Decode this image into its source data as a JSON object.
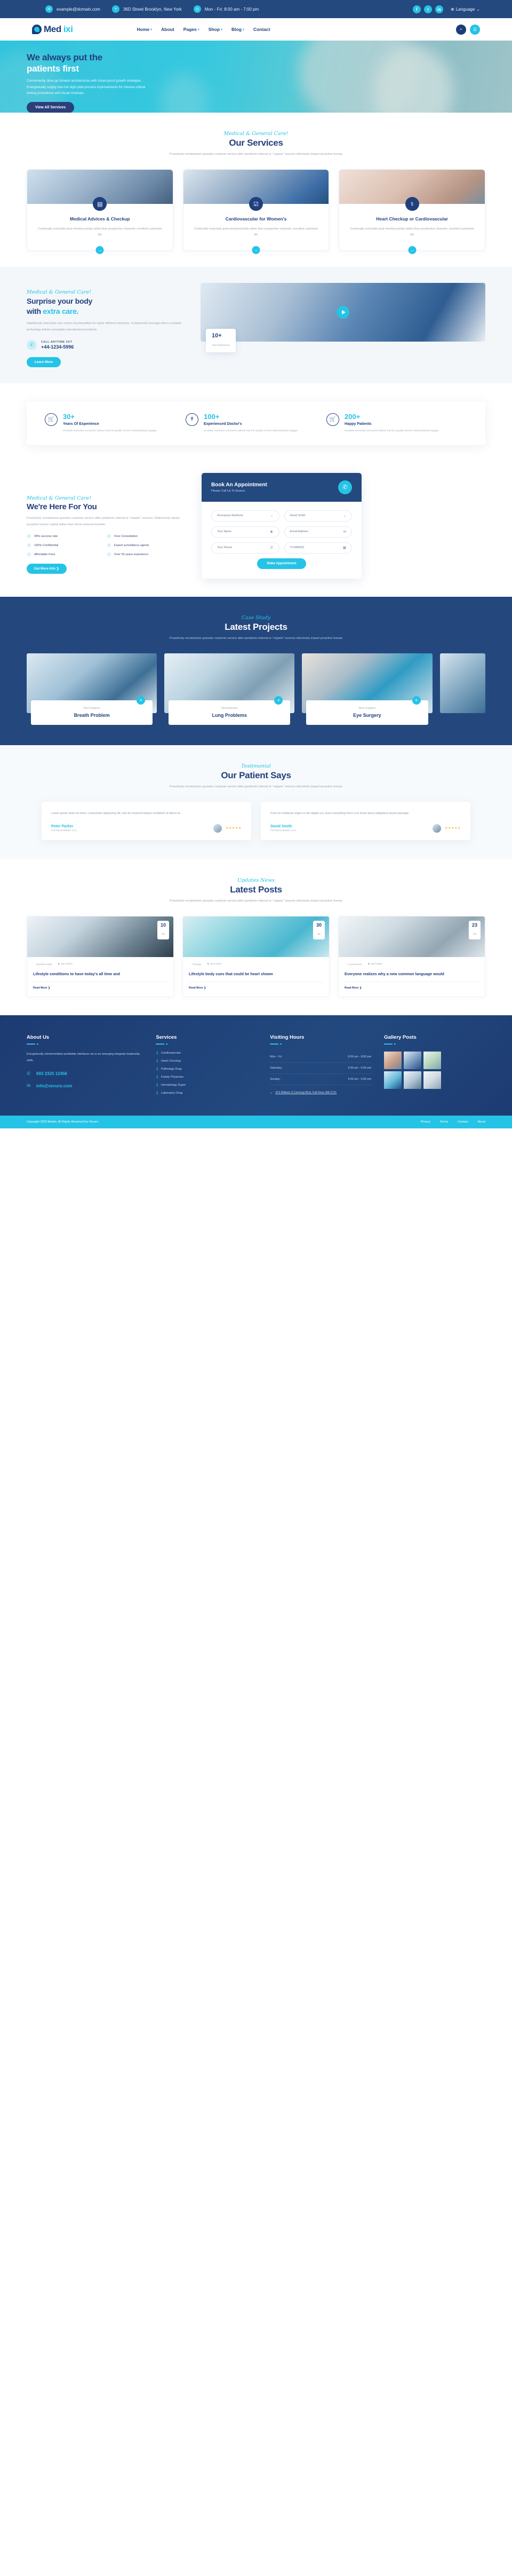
{
  "topbar": {
    "email": "example@domain.com",
    "address": "36D Street Brooklyn, New York",
    "hours": "Mon - Fri: 8:00 am - 7:00 pm",
    "social": [
      "f",
      "t",
      "in"
    ],
    "language": "Language"
  },
  "nav": {
    "brand": "Medixi",
    "brand_prefix": "Med",
    "brand_suffix": "ixi",
    "items": [
      {
        "label": "Home",
        "caret": true
      },
      {
        "label": "About",
        "caret": false
      },
      {
        "label": "Pages",
        "caret": true
      },
      {
        "label": "Shop",
        "caret": true
      },
      {
        "label": "Blog",
        "caret": true
      },
      {
        "label": "Contact",
        "caret": false
      }
    ]
  },
  "hero": {
    "title_line1": "We always put the",
    "title_line2": "patients first",
    "paragraph": "Conveniently drive go forward architectures with future-proof growth strategies. Energistically supply low-risk high-yield process improvements for mission-critical testing procedures and visual mockups.",
    "button": "View All Services"
  },
  "services": {
    "eyebrow": "Medical & General Care!",
    "title": "Our Services",
    "subtitle": "Proactively revolutionize granular customer service after pandemic internal or \"organic\" sources istinctively impact proactive human",
    "cards": [
      {
        "icon": "book-icon",
        "title": "Medical Advices & Checkup",
        "text": "Continually evisculate goal-oriented portals rather than prospective channels. excellent customize life",
        "arrow": "→"
      },
      {
        "icon": "checklist-icon",
        "title": "Cardiovascular for Women's",
        "text": "Continually evisculate goal-oriented portals rather than prospective channels. excellent customize life",
        "arrow": "→"
      },
      {
        "icon": "tooth-icon",
        "title": "Heart Checkup or Cardiovascular",
        "text": "Continually evisculate goal-oriented portals rather than prospective channels. excellent customize life",
        "arrow": "→"
      }
    ]
  },
  "care": {
    "eyebrow": "Medical & General Care!",
    "title_1": "Surprise your body",
    "title_2a": "with ",
    "title_2b": "extra care.",
    "paragraph": "Rapidiously evisculate user-centric functionalities for highly efficient interfaces. Competently leverage other's scalable technology before synergistic manufactured products.",
    "call_label": "CALL ANYTIME 24/7",
    "call_number": "+44-1234-5996",
    "button": "Learn More",
    "badge_value": "10+",
    "badge_label": "Year Experience"
  },
  "stats": [
    {
      "icon": "cart-icon",
      "value": "30+",
      "label": "Years Of Experience",
      "text": "Incubate extensive scenarios without top-line quality vectors authoritatively engage."
    },
    {
      "icon": "doctor-icon",
      "value": "100+",
      "label": "Experienced Doctor's",
      "text": "Incubate extensive scenarios without top-line quality vectors authoritatively engage."
    },
    {
      "icon": "cart2-icon",
      "value": "200+",
      "label": "Happy Patients",
      "text": "Incubate extensive scenarios without top-line quality vectors authoritatively engage."
    }
  ],
  "hfy": {
    "eyebrow": "Medical & General Care!",
    "title": "We're Here For You",
    "paragraph": "Proactively revolutionize granular customer service after pandemic internal or \"organic\" sources. Distinctively impact proactive human capital rather than client-centered benefits.",
    "features": [
      "99% success rate",
      "Free Consultation",
      "100% Confidential",
      "Expert surveillance agents",
      "Affordable Fees",
      "Over 50 years experience"
    ],
    "button": "Get More Info  ❯"
  },
  "appointment": {
    "title": "Book An Appointment",
    "subtitle": "Please Call Us To Ensure",
    "phone_icon": "phone-icon",
    "fields": [
      {
        "value": "Aerospace Medicine",
        "icon": "chevron-down-icon",
        "type": "select"
      },
      {
        "value": "David Smith",
        "icon": "chevron-down-icon",
        "type": "select"
      },
      {
        "value": "Your Name",
        "icon": "user-icon",
        "type": "text"
      },
      {
        "value": "Email Address",
        "icon": "envelope-icon",
        "type": "text"
      },
      {
        "value": "Your Phone",
        "icon": "phone-icon",
        "type": "text"
      },
      {
        "value": "YY/MM/DD",
        "icon": "calendar-icon",
        "type": "date"
      }
    ],
    "submit": "Make Appointment"
  },
  "projects": {
    "eyebrow": "Case Study",
    "title": "Latest Projects",
    "subtitle": "Proactively revolutionize granular customer service after pandemic internal or \"organic\" sources istinctively impact proactive human",
    "cards": [
      {
        "category": "New Surgeon",
        "name": "Breath Problem",
        "plus": "+"
      },
      {
        "category": "Development",
        "name": "Lung Problems",
        "plus": "+"
      },
      {
        "category": "New Surgeon",
        "name": "Eye Surgery",
        "plus": "+"
      }
    ]
  },
  "testimonial": {
    "eyebrow": "Testimonial",
    "title": "Our Patient Says",
    "subtitle": "Proactively revolutionize granular customer service after pandemic internal or \"organic\" sources istinctively impact proactive human",
    "cards": [
      {
        "quote": "Lorem ipsum dolor sit amet, consectetur adipiscing elit, sed do eiusmod tempor incididunt ut labore et",
        "name": "Peter Parker",
        "role": "Full Stack Master, LLC",
        "stars": "★★★★★"
      },
      {
        "quote": "From its medieval origins to the digital era, learn everything there is to know about ubiquitous ipsum passage",
        "name": "David Smith",
        "role": "Full Stack Master, LLC",
        "stars": "★★★★★"
      }
    ]
  },
  "blog": {
    "eyebrow": "Updates News",
    "title": "Latest Posts",
    "subtitle": "Proactively revolutionize granular customer service after pandemic internal or \"organic\" sources istinctively impact proactive human",
    "posts": [
      {
        "day": "10",
        "month": "Jan",
        "category": "Mental Health",
        "author": "wp-medixi",
        "title": "Lifestyle conditions to have today's all time and",
        "more": "Read More  ❯"
      },
      {
        "day": "30",
        "month": "Jan",
        "category": "Therapy",
        "author": "wp-medixi",
        "title": "Lifestyle body cues that could be heart shown",
        "more": "Read More  ❯"
      },
      {
        "day": "23",
        "month": "Jan",
        "category": "Acupressure",
        "author": "wp-medixi",
        "title": "Everyone realizes why a new common language would",
        "more": "Read More  ❯"
      }
    ]
  },
  "footer": {
    "about": {
      "title": "About Us",
      "text": "Energistically reintermediate worldwide interfaces vis-a-vis emerging integrate leadership skills.",
      "phone": "693 2325 12456",
      "email": "info@vecuro.com"
    },
    "services": {
      "title": "Services",
      "items": [
        "Cardiovascular",
        "Heart Checkup",
        "Pathology Drag",
        "Family Physician",
        "Hematology Super",
        "Laboratory Drag"
      ]
    },
    "hours": {
      "title": "Visiting Hours",
      "rows": [
        {
          "day": "Mon - Fri:",
          "time": "8:00 am - 8:00 pm"
        },
        {
          "day": "Saturday:",
          "time": "9:00 am - 6:00 pm"
        },
        {
          "day": "Sunday:",
          "time": "9:00 am - 6:00 pm"
        }
      ],
      "address": "374 William S Canning Blvd, Fall River MA 2721"
    },
    "gallery": {
      "title": "Gallery Posts"
    },
    "copyright": "Copyright 2023 Medixi, All Rights Reserved by Vecuro",
    "links": [
      "Privacy",
      "Terms",
      "Contact",
      "About"
    ]
  },
  "colors": {
    "navy": "#23497f",
    "cyan": "#25c3e6",
    "deep": "#1b3c77"
  }
}
